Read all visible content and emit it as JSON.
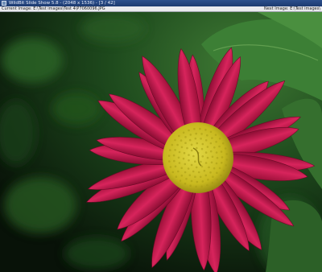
{
  "window": {
    "title": "WildBit Slide Show 5.8 - (2048 x 1536) - [3 / 42]"
  },
  "infobar": {
    "current_image_text": "Current Image: E:\\Test images\\Test 4\\P7060096.JPG",
    "next_image_text": "Next Image: E:\\Test images\\"
  },
  "image": {
    "subject": "pink-daisy-flower"
  },
  "colors": {
    "titlebar": "#1c3a70",
    "infobar": "#e9eaee",
    "petal": "#c01a4a",
    "flower_center": "#d4c72a",
    "foliage": "#2f6a2a"
  }
}
